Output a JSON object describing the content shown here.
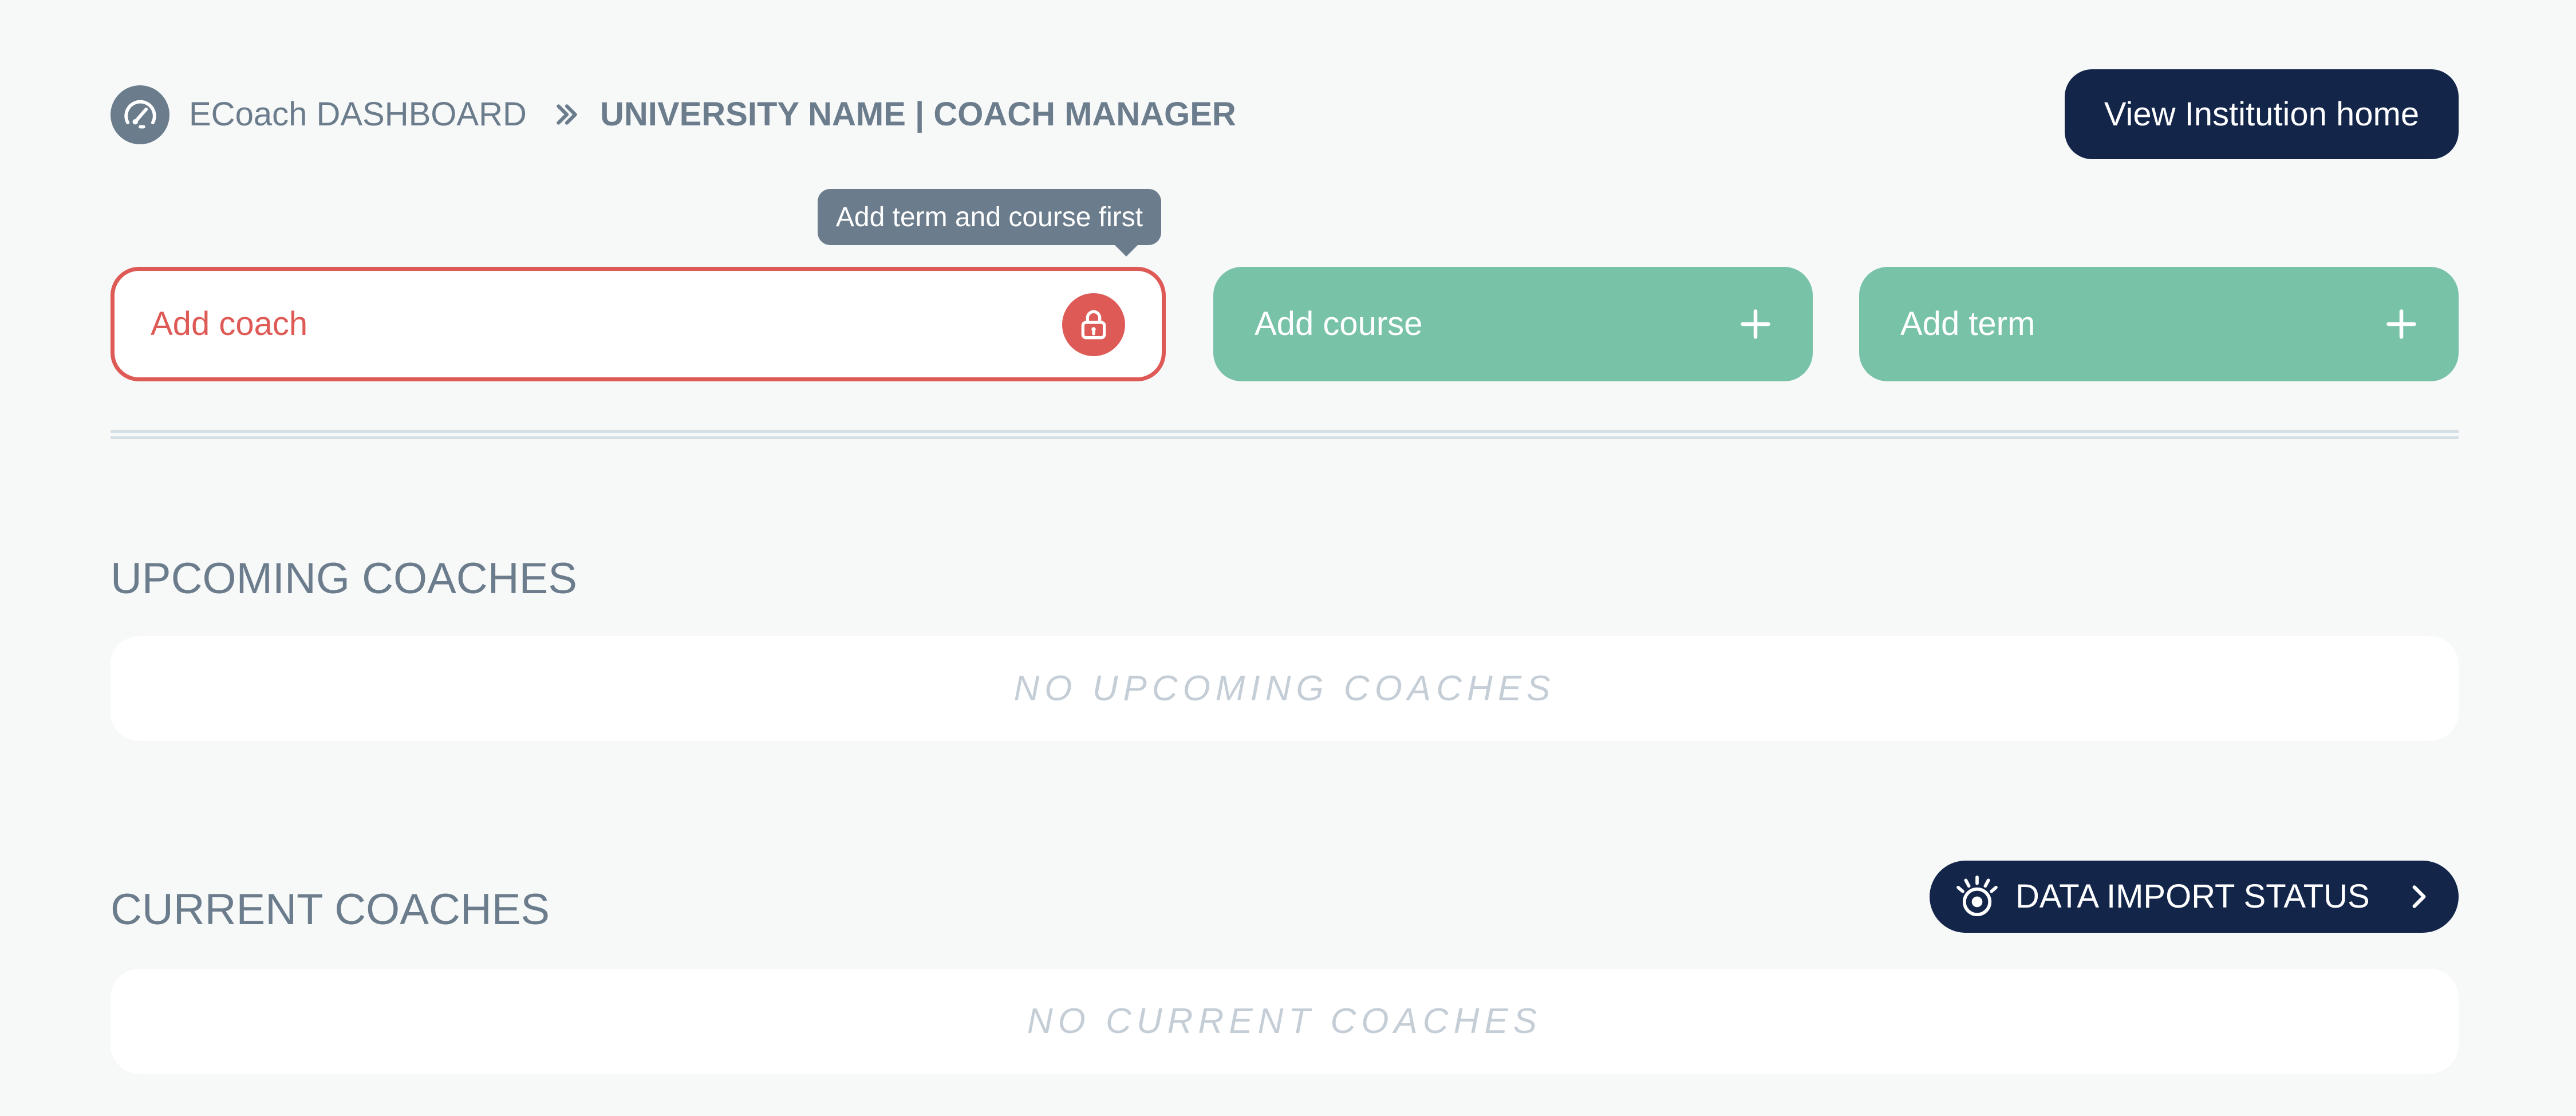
{
  "header": {
    "dashboard_icon": "speedometer-icon",
    "breadcrumb_home": "ECoach DASHBOARD",
    "breadcrumb_separator_icon": "double-chevron-right-icon",
    "breadcrumb_current": "UNIVERSITY NAME | COACH MANAGER",
    "view_home_label": "View Institution home"
  },
  "tooltip": {
    "text": "Add term and course first"
  },
  "actions": {
    "add_coach_label": "Add coach",
    "add_coach_icon": "lock-icon",
    "add_coach_locked": true,
    "add_course_label": "Add course",
    "add_term_label": "Add term",
    "add_icon": "plus-icon"
  },
  "upcoming": {
    "title": "UPCOMING COACHES",
    "empty_text": "NO UPCOMING COACHES"
  },
  "current": {
    "title": "CURRENT COACHES",
    "empty_text": "NO CURRENT COACHES",
    "import_status_label": "DATA IMPORT STATUS",
    "import_status_icon": "eye-icon",
    "import_status_chevron": "chevron-right-icon"
  },
  "colors": {
    "background": "#f7f8f8",
    "navy": "#13264a",
    "slate": "#6b7c8c",
    "green": "#78c2a8",
    "danger": "#de5a56",
    "empty_text": "#c5ced6",
    "divider": "#d6dfe6"
  }
}
